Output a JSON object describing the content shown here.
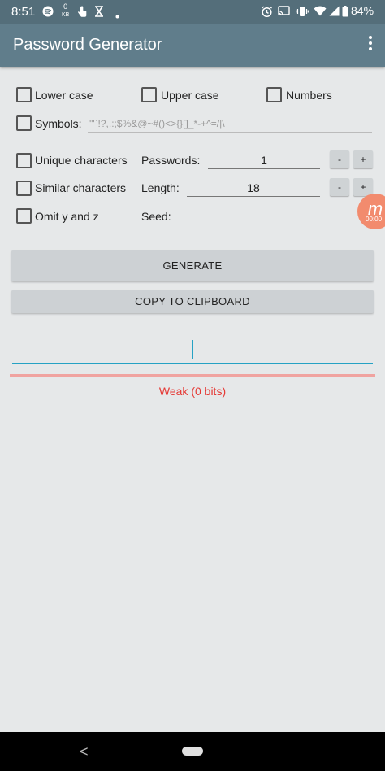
{
  "status": {
    "time": "8:51",
    "kb_top": "0",
    "kb_bottom": "KB",
    "battery": "84%"
  },
  "app": {
    "title": "Password Generator"
  },
  "options": {
    "lower_case": "Lower case",
    "upper_case": "Upper case",
    "numbers": "Numbers",
    "symbols_label": "Symbols:",
    "symbols_value": "'\"`!?,.:;$%&@~#()<>{}[]_*-+^=/|\\",
    "unique_chars": "Unique characters",
    "similar_chars": "Similar characters",
    "omit_yz": "Omit y and z"
  },
  "settings": {
    "passwords_label": "Passwords:",
    "passwords_value": "1",
    "length_label": "Length:",
    "length_value": "18",
    "seed_label": "Seed:",
    "seed_value": "",
    "minus": "-",
    "plus": "+"
  },
  "actions": {
    "generate": "GENERATE",
    "copy": "COPY TO CLIPBOARD"
  },
  "result": {
    "password": "",
    "strength": "Weak (0 bits)",
    "strength_color": "#e53935",
    "accent_color": "#26a2c4"
  },
  "overlay": {
    "letter": "m",
    "time": "00:00"
  },
  "nav": {
    "back": "<"
  }
}
